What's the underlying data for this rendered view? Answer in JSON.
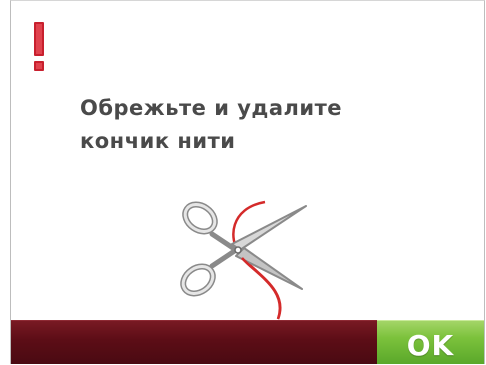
{
  "dialog": {
    "message_line1": "Обрежьте и удалите",
    "message_line2": "кончик нити",
    "alert_icon": "exclamation-icon",
    "illustration_icon": "scissors-cutting-thread-icon"
  },
  "footer": {
    "ok_label": "OK"
  },
  "colors": {
    "alert": "#c8202e",
    "thread": "#d42a2a",
    "bar": "#5c0d16",
    "ok_button": "#7cc23c",
    "text": "#4a4a4a"
  }
}
